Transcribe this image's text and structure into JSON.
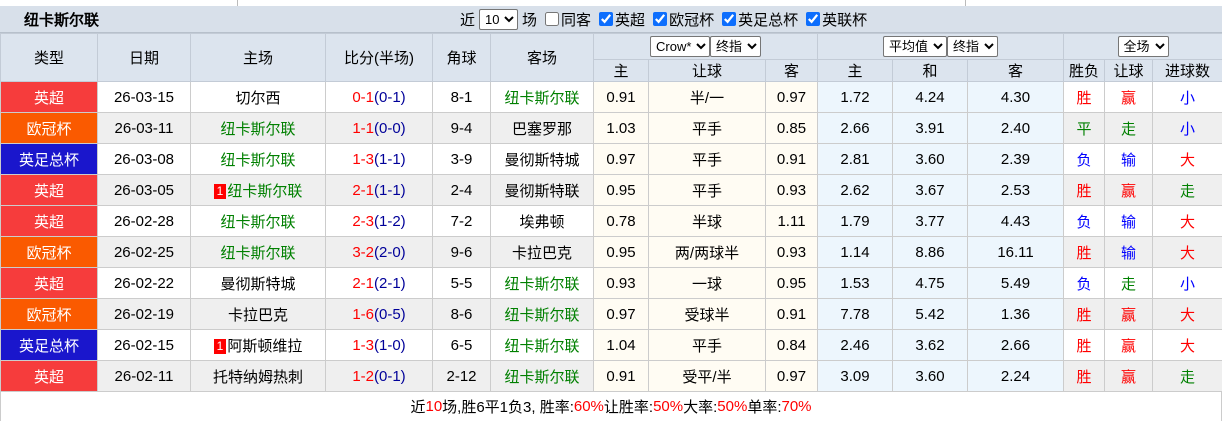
{
  "title": "纽卡斯尔联",
  "controls": {
    "near_label": "近",
    "matches_select_value": "10",
    "games_label": "场",
    "same_away": {
      "label": "同客",
      "checked": false
    },
    "leagues": [
      {
        "label": "英超",
        "checked": true
      },
      {
        "label": "欧冠杯",
        "checked": true
      },
      {
        "label": "英足总杯",
        "checked": true
      },
      {
        "label": "英联杯",
        "checked": true
      }
    ]
  },
  "header": {
    "static_cols": [
      "类型",
      "日期",
      "主场",
      "比分(半场)",
      "角球",
      "客场"
    ],
    "odds_group": {
      "select1": "Crow*",
      "select2": "终指",
      "sub": [
        "主",
        "让球",
        "客"
      ]
    },
    "avg_group": {
      "select1": "平均值",
      "select2": "终指",
      "sub": [
        "主",
        "和",
        "客"
      ]
    },
    "result_group": {
      "select1": "全场",
      "sub": [
        "胜负",
        "让球",
        "进球数"
      ]
    }
  },
  "palette": {
    "red": "#ff0000",
    "green": "#008000",
    "blue": "#0000ff",
    "score_halftime": "#000099",
    "league_premier": "#f63c3c",
    "league_ucl": "#fa5a00",
    "league_facup": "#1a16cc"
  },
  "rows": [
    {
      "league": {
        "label": "英超",
        "color": "#f63c3c"
      },
      "date": "26-03-15",
      "home": {
        "name": "切尔西",
        "green": false,
        "badge": ""
      },
      "score": {
        "ft": "0-1",
        "ht": "(0-1)"
      },
      "corner": "8-1",
      "away": {
        "name": "纽卡斯尔联",
        "green": true,
        "badge": ""
      },
      "odds": [
        "0.91",
        "半/一",
        "0.97"
      ],
      "avg": [
        "1.72",
        "4.24",
        "4.30"
      ],
      "results": [
        {
          "text": "胜",
          "color": "#ff0000"
        },
        {
          "text": "赢",
          "color": "#ff0000"
        },
        {
          "text": "小",
          "color": "#0000ff"
        }
      ]
    },
    {
      "league": {
        "label": "欧冠杯",
        "color": "#fa5a00"
      },
      "date": "26-03-11",
      "home": {
        "name": "纽卡斯尔联",
        "green": true,
        "badge": ""
      },
      "score": {
        "ft": "1-1",
        "ht": "(0-0)"
      },
      "corner": "9-4",
      "away": {
        "name": "巴塞罗那",
        "green": false,
        "badge": ""
      },
      "odds": [
        "1.03",
        "平手",
        "0.85"
      ],
      "avg": [
        "2.66",
        "3.91",
        "2.40"
      ],
      "results": [
        {
          "text": "平",
          "color": "#008000"
        },
        {
          "text": "走",
          "color": "#008000"
        },
        {
          "text": "小",
          "color": "#0000ff"
        }
      ]
    },
    {
      "league": {
        "label": "英足总杯",
        "color": "#1a16cc"
      },
      "date": "26-03-08",
      "home": {
        "name": "纽卡斯尔联",
        "green": true,
        "badge": ""
      },
      "score": {
        "ft": "1-3",
        "ht": "(1-1)"
      },
      "corner": "3-9",
      "away": {
        "name": "曼彻斯特城",
        "green": false,
        "badge": ""
      },
      "odds": [
        "0.97",
        "平手",
        "0.91"
      ],
      "avg": [
        "2.81",
        "3.60",
        "2.39"
      ],
      "results": [
        {
          "text": "负",
          "color": "#0000ff"
        },
        {
          "text": "输",
          "color": "#0000ff"
        },
        {
          "text": "大",
          "color": "#ff0000"
        }
      ]
    },
    {
      "league": {
        "label": "英超",
        "color": "#f63c3c"
      },
      "date": "26-03-05",
      "home": {
        "name": "纽卡斯尔联",
        "green": true,
        "badge": "1"
      },
      "score": {
        "ft": "2-1",
        "ht": "(1-1)"
      },
      "corner": "2-4",
      "away": {
        "name": "曼彻斯特联",
        "green": false,
        "badge": ""
      },
      "odds": [
        "0.95",
        "平手",
        "0.93"
      ],
      "avg": [
        "2.62",
        "3.67",
        "2.53"
      ],
      "results": [
        {
          "text": "胜",
          "color": "#ff0000"
        },
        {
          "text": "赢",
          "color": "#ff0000"
        },
        {
          "text": "走",
          "color": "#008000"
        }
      ]
    },
    {
      "league": {
        "label": "英超",
        "color": "#f63c3c"
      },
      "date": "26-02-28",
      "home": {
        "name": "纽卡斯尔联",
        "green": true,
        "badge": ""
      },
      "score": {
        "ft": "2-3",
        "ht": "(1-2)"
      },
      "corner": "7-2",
      "away": {
        "name": "埃弗顿",
        "green": false,
        "badge": ""
      },
      "odds": [
        "0.78",
        "半球",
        "1.11"
      ],
      "avg": [
        "1.79",
        "3.77",
        "4.43"
      ],
      "results": [
        {
          "text": "负",
          "color": "#0000ff"
        },
        {
          "text": "输",
          "color": "#0000ff"
        },
        {
          "text": "大",
          "color": "#ff0000"
        }
      ]
    },
    {
      "league": {
        "label": "欧冠杯",
        "color": "#fa5a00"
      },
      "date": "26-02-25",
      "home": {
        "name": "纽卡斯尔联",
        "green": true,
        "badge": ""
      },
      "score": {
        "ft": "3-2",
        "ht": "(2-0)"
      },
      "corner": "9-6",
      "away": {
        "name": "卡拉巴克",
        "green": false,
        "badge": ""
      },
      "odds": [
        "0.95",
        "两/两球半",
        "0.93"
      ],
      "avg": [
        "1.14",
        "8.86",
        "16.11"
      ],
      "results": [
        {
          "text": "胜",
          "color": "#ff0000"
        },
        {
          "text": "输",
          "color": "#0000ff"
        },
        {
          "text": "大",
          "color": "#ff0000"
        }
      ]
    },
    {
      "league": {
        "label": "英超",
        "color": "#f63c3c"
      },
      "date": "26-02-22",
      "home": {
        "name": "曼彻斯特城",
        "green": false,
        "badge": ""
      },
      "score": {
        "ft": "2-1",
        "ht": "(2-1)"
      },
      "corner": "5-5",
      "away": {
        "name": "纽卡斯尔联",
        "green": true,
        "badge": ""
      },
      "odds": [
        "0.93",
        "一球",
        "0.95"
      ],
      "avg": [
        "1.53",
        "4.75",
        "5.49"
      ],
      "results": [
        {
          "text": "负",
          "color": "#0000ff"
        },
        {
          "text": "走",
          "color": "#008000"
        },
        {
          "text": "小",
          "color": "#0000ff"
        }
      ]
    },
    {
      "league": {
        "label": "欧冠杯",
        "color": "#fa5a00"
      },
      "date": "26-02-19",
      "home": {
        "name": "卡拉巴克",
        "green": false,
        "badge": ""
      },
      "score": {
        "ft": "1-6",
        "ht": "(0-5)"
      },
      "corner": "8-6",
      "away": {
        "name": "纽卡斯尔联",
        "green": true,
        "badge": ""
      },
      "odds": [
        "0.97",
        "受球半",
        "0.91"
      ],
      "avg": [
        "7.78",
        "5.42",
        "1.36"
      ],
      "results": [
        {
          "text": "胜",
          "color": "#ff0000"
        },
        {
          "text": "赢",
          "color": "#ff0000"
        },
        {
          "text": "大",
          "color": "#ff0000"
        }
      ]
    },
    {
      "league": {
        "label": "英足总杯",
        "color": "#1a16cc"
      },
      "date": "26-02-15",
      "home": {
        "name": "阿斯顿维拉",
        "green": false,
        "badge": "1"
      },
      "score": {
        "ft": "1-3",
        "ht": "(1-0)"
      },
      "corner": "6-5",
      "away": {
        "name": "纽卡斯尔联",
        "green": true,
        "badge": ""
      },
      "odds": [
        "1.04",
        "平手",
        "0.84"
      ],
      "avg": [
        "2.46",
        "3.62",
        "2.66"
      ],
      "results": [
        {
          "text": "胜",
          "color": "#ff0000"
        },
        {
          "text": "赢",
          "color": "#ff0000"
        },
        {
          "text": "大",
          "color": "#ff0000"
        }
      ]
    },
    {
      "league": {
        "label": "英超",
        "color": "#f63c3c"
      },
      "date": "26-02-11",
      "home": {
        "name": "托特纳姆热刺",
        "green": false,
        "badge": ""
      },
      "score": {
        "ft": "1-2",
        "ht": "(0-1)"
      },
      "corner": "2-12",
      "away": {
        "name": "纽卡斯尔联",
        "green": true,
        "badge": ""
      },
      "odds": [
        "0.91",
        "受平/半",
        "0.97"
      ],
      "avg": [
        "3.09",
        "3.60",
        "2.24"
      ],
      "results": [
        {
          "text": "胜",
          "color": "#ff0000"
        },
        {
          "text": "赢",
          "color": "#ff0000"
        },
        {
          "text": "走",
          "color": "#008000"
        }
      ]
    }
  ],
  "footer": {
    "segments": [
      {
        "text": "近",
        "red": false
      },
      {
        "text": "10",
        "red": true
      },
      {
        "text": "场,胜6平1负3, 胜率:",
        "red": false
      },
      {
        "text": "60%",
        "red": true
      },
      {
        "text": " 让胜率:",
        "red": false
      },
      {
        "text": "50%",
        "red": true
      },
      {
        "text": " 大率:",
        "red": false
      },
      {
        "text": "50%",
        "red": true
      },
      {
        "text": " 单率:",
        "red": false
      },
      {
        "text": "70%",
        "red": true
      }
    ]
  }
}
